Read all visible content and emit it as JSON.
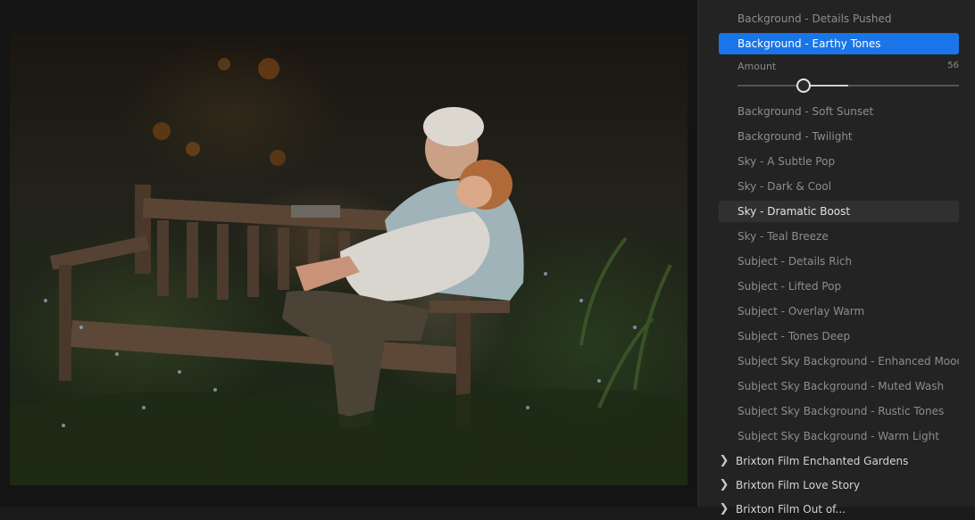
{
  "presets_before": [
    "Background - Details Pushed",
    "Background - Earthy Tones"
  ],
  "selected_preset": "Background - Earthy Tones",
  "amount": {
    "label": "Amount",
    "value": "56"
  },
  "presets_after": [
    "Background - Soft Sunset",
    "Background - Twilight",
    "Sky - A Subtle Pop",
    "Sky - Dark & Cool",
    "Sky - Dramatic Boost",
    "Sky - Teal Breeze",
    "Subject - Details Rich",
    "Subject - Lifted Pop",
    "Subject - Overlay Warm",
    "Subject - Tones Deep",
    "Subject Sky Background - Enhanced Mood",
    "Subject Sky Background - Muted Wash",
    "Subject Sky Background - Rustic Tones",
    "Subject Sky Background - Warm Light"
  ],
  "hovered_preset": "Sky - Dramatic Boost",
  "groups": [
    "Brixton Film Enchanted Gardens",
    "Brixton Film Love Story",
    "Brixton Film Out of..."
  ],
  "icons": {
    "chevron": "chevron-right-icon"
  },
  "colors": {
    "selected_bg": "#1a75e8",
    "sidebar_bg": "#232323",
    "canvas_bg": "#141414"
  }
}
